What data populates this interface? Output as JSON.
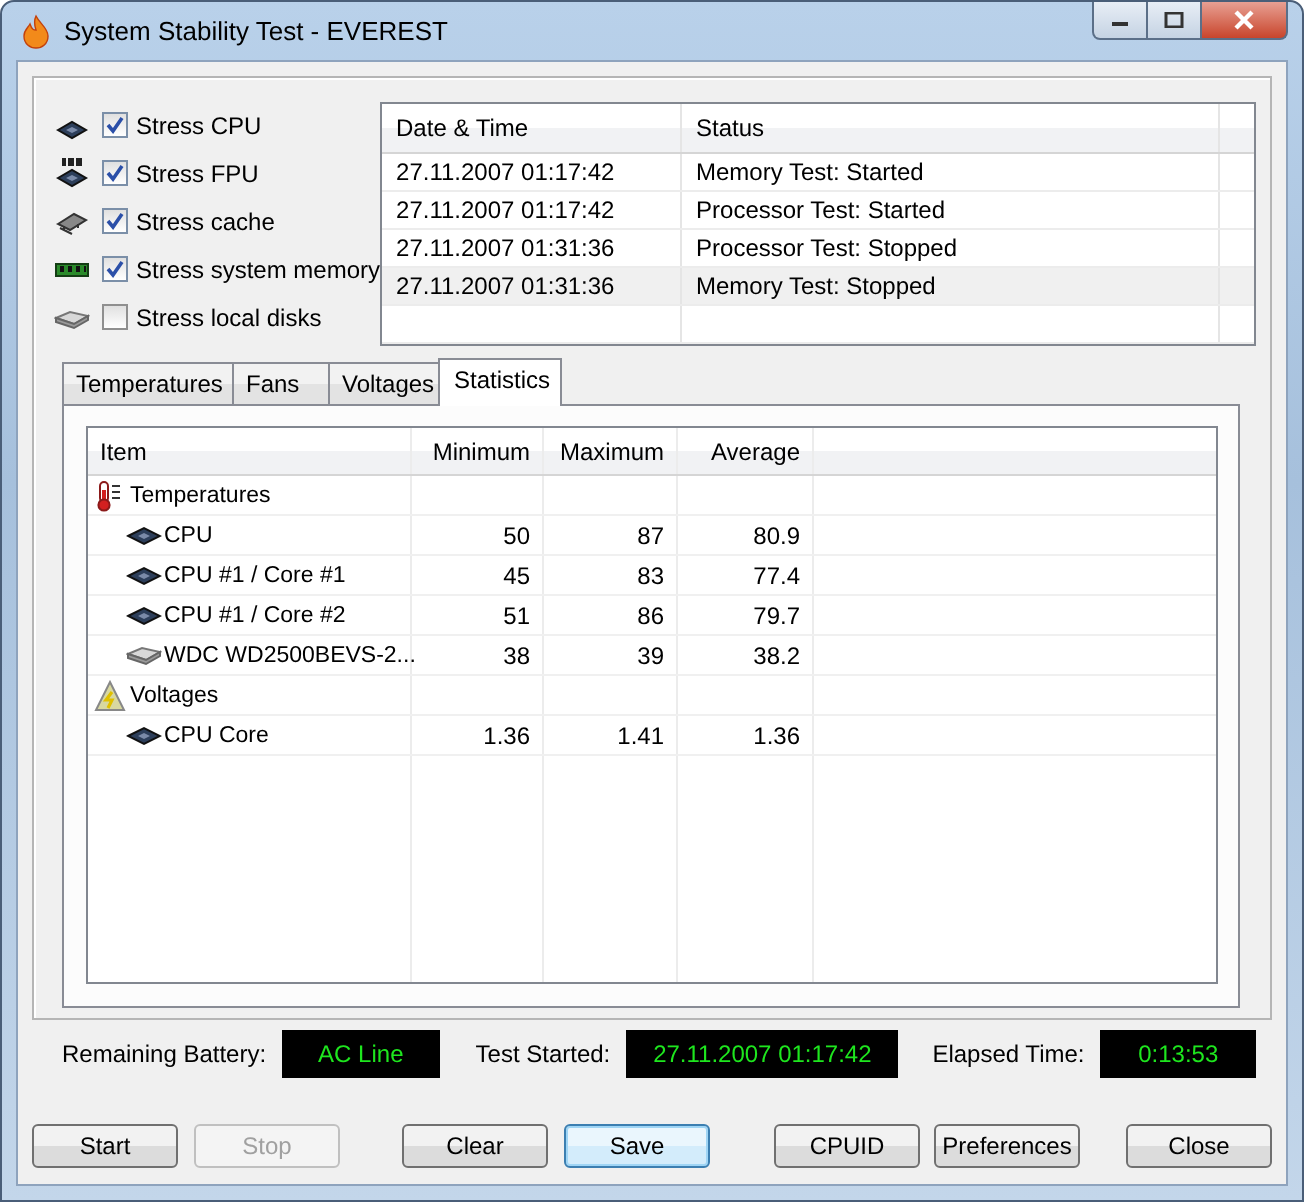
{
  "window": {
    "title": "System Stability Test - EVEREST"
  },
  "stress_options": [
    {
      "label": "Stress CPU",
      "kind": "cpu",
      "checked": true
    },
    {
      "label": "Stress FPU",
      "kind": "fpu",
      "checked": true
    },
    {
      "label": "Stress cache",
      "kind": "cache",
      "checked": true
    },
    {
      "label": "Stress system memory",
      "kind": "memory",
      "checked": true
    },
    {
      "label": "Stress local disks",
      "kind": "disk",
      "checked": false
    }
  ],
  "log": {
    "columns": [
      "Date & Time",
      "Status"
    ],
    "rows": [
      {
        "time": "27.11.2007 01:17:42",
        "status": "Memory Test: Started",
        "selected": false
      },
      {
        "time": "27.11.2007 01:17:42",
        "status": "Processor Test: Started",
        "selected": false
      },
      {
        "time": "27.11.2007 01:31:36",
        "status": "Processor Test: Stopped",
        "selected": false
      },
      {
        "time": "27.11.2007 01:31:36",
        "status": "Memory Test: Stopped",
        "selected": true
      }
    ]
  },
  "tabs": [
    {
      "label": "Temperatures",
      "selected": false
    },
    {
      "label": "Fans",
      "selected": false
    },
    {
      "label": "Voltages",
      "selected": false
    },
    {
      "label": "Statistics",
      "selected": true
    }
  ],
  "statistics": {
    "columns": [
      "Item",
      "Minimum",
      "Maximum",
      "Average"
    ],
    "groups": [
      {
        "name": "Temperatures",
        "kind": "thermometer",
        "children": [
          {
            "name": "CPU",
            "kind": "cpu",
            "minimum": "50",
            "maximum": "87",
            "average": "80.9"
          },
          {
            "name": "CPU #1 / Core #1",
            "kind": "cpu",
            "minimum": "45",
            "maximum": "83",
            "average": "77.4"
          },
          {
            "name": "CPU #1 / Core #2",
            "kind": "cpu",
            "minimum": "51",
            "maximum": "86",
            "average": "79.7"
          },
          {
            "name": "WDC WD2500BEVS-2...",
            "kind": "disk",
            "minimum": "38",
            "maximum": "39",
            "average": "38.2"
          }
        ]
      },
      {
        "name": "Voltages",
        "kind": "warning",
        "children": [
          {
            "name": "CPU Core",
            "kind": "cpu",
            "minimum": "1.36",
            "maximum": "1.41",
            "average": "1.36"
          }
        ]
      }
    ]
  },
  "status": [
    {
      "label": "Remaining Battery:",
      "value": "AC Line"
    },
    {
      "label": "Test Started:",
      "value": "27.11.2007 01:17:42"
    },
    {
      "label": "Elapsed Time:",
      "value": "0:13:53"
    }
  ],
  "buttons": [
    {
      "label": "Start",
      "disabled": false,
      "focused": false
    },
    {
      "label": "Stop",
      "disabled": true,
      "focused": false
    },
    {
      "label": "Clear",
      "disabled": false,
      "focused": false
    },
    {
      "label": "Save",
      "disabled": false,
      "focused": true
    },
    {
      "label": "CPUID",
      "disabled": false,
      "focused": false
    },
    {
      "label": "Preferences",
      "disabled": false,
      "focused": false
    },
    {
      "label": "Close",
      "disabled": false,
      "focused": false
    }
  ]
}
